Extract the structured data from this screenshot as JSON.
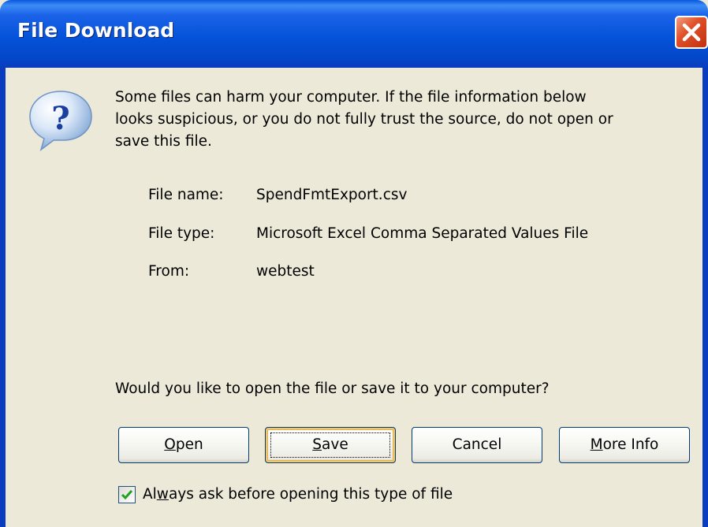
{
  "window": {
    "title": "File Download",
    "close_icon": "close-icon",
    "accent_color": "#0453d8"
  },
  "message": {
    "icon": "question-icon",
    "line1": "Some files can harm your computer. If the file information below",
    "line2": "looks suspicious, or you do not fully trust the source, do not open or",
    "line3": "save this file."
  },
  "file_info": {
    "name_label": "File name:",
    "name_value": "SpendFmtExport.csv",
    "type_label": "File type:",
    "type_value": "Microsoft Excel Comma Separated Values File",
    "from_label": "From:",
    "from_value": "webtest"
  },
  "question": "Would you like to open the file or save it to your computer?",
  "buttons": {
    "open": {
      "mnemonic": "O",
      "rest": "pen"
    },
    "save": {
      "mnemonic": "S",
      "rest": "ave"
    },
    "cancel": {
      "label": "Cancel"
    },
    "more_info": {
      "mnemonic": "M",
      "rest": "ore Info"
    }
  },
  "always_ask": {
    "checked": true,
    "pre": "Al",
    "mnemonic": "w",
    "post": "ays ask before opening this type of file"
  }
}
